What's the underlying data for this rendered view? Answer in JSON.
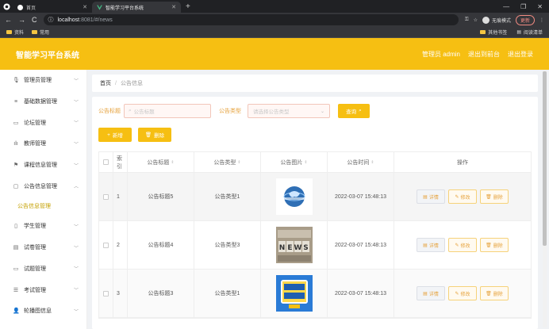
{
  "browser": {
    "tabs": [
      {
        "title": "首页",
        "active": false
      },
      {
        "title": "智能学习平台系统",
        "active": true
      }
    ],
    "new_tab": "+",
    "address": {
      "host": "localhost",
      "rest": ":8081/#/news"
    },
    "incognito_label": "无痕模式",
    "update_label": "更新",
    "bookmarks": [
      "资料",
      "常用"
    ],
    "bookmarks_right": [
      "其他书签",
      "阅读清单"
    ]
  },
  "header": {
    "app_title": "智能学习平台系统",
    "user": "管理员 admin",
    "back_to_front": "退出到前台",
    "logout": "退出登录"
  },
  "sidebar": {
    "items": [
      {
        "label": "管理员管理",
        "icon": "mic-icon",
        "glyph": "🎙"
      },
      {
        "label": "基础数据管理",
        "icon": "list-icon",
        "glyph": "≡"
      },
      {
        "label": "论坛管理",
        "icon": "monitor-icon",
        "glyph": "▭"
      },
      {
        "label": "教师管理",
        "icon": "bar-chart-icon",
        "glyph": "ılı"
      },
      {
        "label": "课程信息管理",
        "icon": "flag-icon",
        "glyph": "⚑"
      },
      {
        "label": "公告信息管理",
        "icon": "message-icon",
        "glyph": "▢"
      },
      {
        "label": "学生管理",
        "icon": "phone-icon",
        "glyph": "▯"
      },
      {
        "label": "试卷管理",
        "icon": "document-icon",
        "glyph": "▤"
      },
      {
        "label": "试题管理",
        "icon": "monitor-icon",
        "glyph": "▭"
      },
      {
        "label": "考试管理",
        "icon": "sliders-icon",
        "glyph": "☰"
      },
      {
        "label": "轮播图信息",
        "icon": "user-icon",
        "glyph": "👤"
      }
    ],
    "submenu": {
      "label": "公告信息管理"
    }
  },
  "breadcrumb": {
    "home": "首页",
    "sep": "/",
    "current": "公告信息"
  },
  "filters": {
    "title_label": "公告标题",
    "title_placeholder": "公告标题",
    "type_label": "公告类型",
    "type_placeholder": "请选择公告类型",
    "search_label": "查询"
  },
  "actions": {
    "add_label": "新增",
    "delete_label": "删除"
  },
  "table": {
    "columns": {
      "index": "索引",
      "title": "公告标题",
      "type": "公告类型",
      "picture": "公告图片",
      "time": "公告时间",
      "operation": "操作"
    },
    "rows": [
      {
        "index": "1",
        "title": "公告标题5",
        "type": "公告类型1",
        "time": "2022-03-07 15:48:13",
        "image": "globe"
      },
      {
        "index": "2",
        "title": "公告标题4",
        "type": "公告类型3",
        "time": "2022-03-07 15:48:13",
        "image": "news"
      },
      {
        "index": "3",
        "title": "公告标题3",
        "type": "公告类型1",
        "time": "2022-03-07 15:48:13",
        "image": "hotnews"
      }
    ],
    "op_labels": {
      "detail": "详情",
      "edit": "修改",
      "delete": "删除"
    }
  },
  "colors": {
    "primary": "#f6bf12",
    "accent_text": "#e6a23c"
  }
}
